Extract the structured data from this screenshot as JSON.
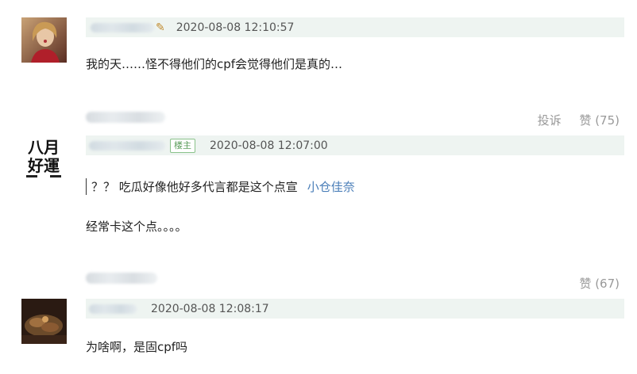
{
  "comments": [
    {
      "time": "2020-08-08 12:10:57",
      "content": "我的天……怪不得他们的cpf会觉得他们是真的…"
    },
    {
      "actions": {
        "report": "投诉",
        "like": "赞 (75)"
      },
      "badge": "楼主",
      "time": "2020-08-08 12:07:00",
      "avatar_text": {
        "line1": "八月",
        "line2": "好運"
      },
      "quote": {
        "text": "？？ 吃瓜好像他好多代言都是这个点宣",
        "link": "小仓佳奈"
      },
      "content": "经常卡这个点。。。。"
    },
    {
      "actions": {
        "like": "赞 (67)"
      },
      "time": "2020-08-08 12:08:17",
      "content": "为啥啊，是固cpf吗"
    }
  ],
  "colors": {
    "header_bg": "#eef4f1",
    "link": "#4a7eb8",
    "badge_border": "#8ac28a",
    "action_text": "#999999"
  }
}
